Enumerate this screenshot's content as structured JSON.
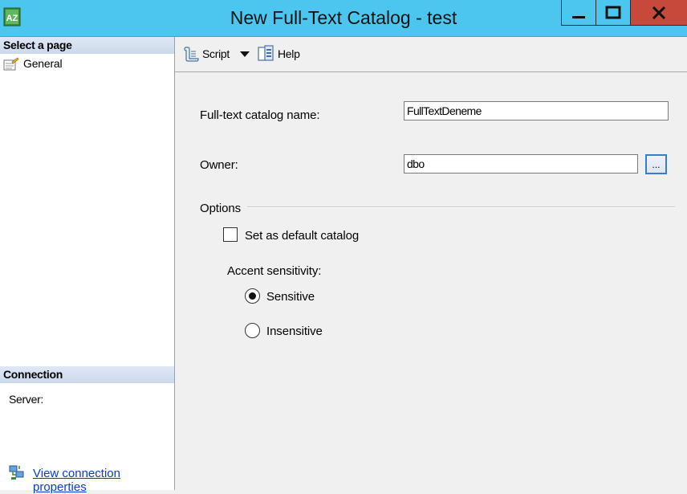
{
  "window": {
    "title": "New Full-Text Catalog - test",
    "min_symbol": "▁",
    "max_symbol": "□",
    "close_symbol": "X",
    "titlebar_color": "#4dc6ef",
    "close_color": "#c7493c"
  },
  "sidebar": {
    "select_page_header": "Select a page",
    "pages": [
      {
        "label": "General",
        "icon": "page-settings-icon"
      }
    ],
    "connection_header": "Connection",
    "server_label": "Server:",
    "view_connection_link": "View connection properties",
    "link_color": "#0a3dca"
  },
  "toolbar": {
    "script_label": "Script",
    "help_label": "Help",
    "script_icon": "script-scroll-icon",
    "help_icon": "help-book-icon"
  },
  "form": {
    "catalog_name_label": "Full-text catalog name:",
    "catalog_name_value": "FullTextDeneme",
    "owner_label": "Owner:",
    "owner_value": "dbo",
    "browse_label": "...",
    "options_label": "Options",
    "default_catalog_label": "Set as default catalog",
    "default_catalog_checked": false,
    "accent_label": "Accent sensitivity:",
    "accent_options": [
      {
        "label": "Sensitive",
        "selected": true
      },
      {
        "label": "Insensitive",
        "selected": false
      }
    ]
  }
}
